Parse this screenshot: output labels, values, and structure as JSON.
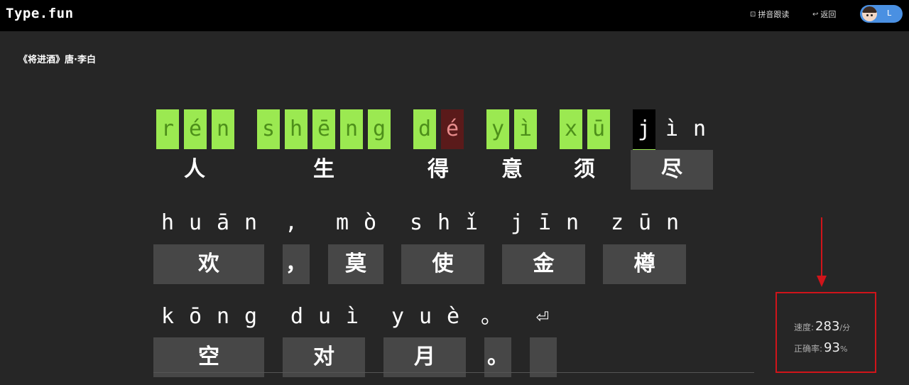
{
  "header": {
    "logo": "Type.fun",
    "pinyin_follow": "拼音跟读",
    "back": "返回",
    "user_initial": "L"
  },
  "poem": {
    "title": "《将进酒》唐·李白"
  },
  "lines": [
    {
      "pinyin": [
        {
          "c": "r",
          "s": "ok"
        },
        {
          "c": "é",
          "s": "ok"
        },
        {
          "c": "n",
          "s": "ok"
        },
        {
          "c": "s",
          "s": "ok"
        },
        {
          "c": "h",
          "s": "ok"
        },
        {
          "c": "ē",
          "s": "ok"
        },
        {
          "c": "n",
          "s": "ok"
        },
        {
          "c": "g",
          "s": "ok"
        },
        {
          "c": "d",
          "s": "ok"
        },
        {
          "c": "é",
          "s": "err"
        },
        {
          "c": "y",
          "s": "ok"
        },
        {
          "c": "ì",
          "s": "ok"
        },
        {
          "c": "x",
          "s": "ok"
        },
        {
          "c": "ū",
          "s": "ok"
        },
        {
          "c": "j",
          "s": "cur"
        },
        {
          "c": "ì",
          "s": ""
        },
        {
          "c": "n",
          "s": ""
        }
      ],
      "chars": [
        "人",
        "生",
        "得",
        "意",
        "须",
        "尽"
      ]
    },
    {
      "pinyin": [
        {
          "c": "h"
        },
        {
          "c": "u"
        },
        {
          "c": "ā"
        },
        {
          "c": "n"
        },
        {
          "c": ","
        },
        {
          "c": "m"
        },
        {
          "c": "ò"
        },
        {
          "c": "s"
        },
        {
          "c": "h"
        },
        {
          "c": "ǐ"
        },
        {
          "c": "j"
        },
        {
          "c": "ī"
        },
        {
          "c": "n"
        },
        {
          "c": "z"
        },
        {
          "c": "ū"
        },
        {
          "c": "n"
        }
      ],
      "chars": [
        "欢",
        "，",
        "莫",
        "使",
        "金",
        "樽"
      ]
    },
    {
      "pinyin": [
        {
          "c": "k"
        },
        {
          "c": "ō"
        },
        {
          "c": "n"
        },
        {
          "c": "g"
        },
        {
          "c": "d"
        },
        {
          "c": "u"
        },
        {
          "c": "ì"
        },
        {
          "c": "y"
        },
        {
          "c": "u"
        },
        {
          "c": "è"
        },
        {
          "c": "。"
        },
        {
          "c": "⏎"
        }
      ],
      "chars": [
        "空",
        "对",
        "月",
        "。",
        ""
      ]
    }
  ],
  "stats": {
    "speed_label": "速度:",
    "speed_value": "283",
    "speed_unit": "/分",
    "accuracy_label": "正确率:",
    "accuracy_value": "93",
    "accuracy_unit": "%"
  },
  "colors": {
    "correct": "#9be951",
    "error": "#5a1a1a",
    "annotation": "#d0141a"
  }
}
